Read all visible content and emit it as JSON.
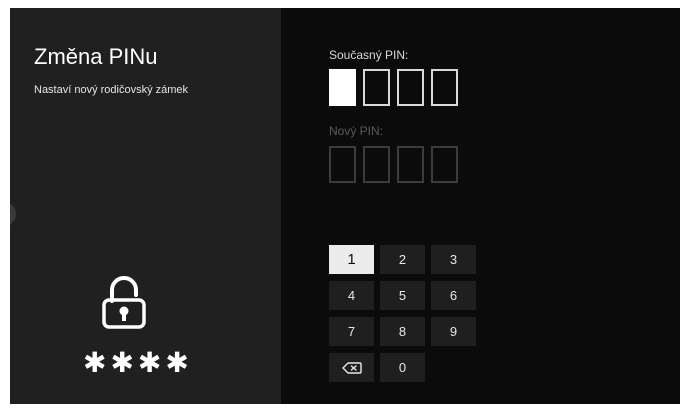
{
  "left": {
    "title": "Změna PINu",
    "subtitle": "Nastaví nový rodičovský zámek",
    "masked_pin": "✱✱✱✱",
    "lock_icon": "padlock-icon"
  },
  "current_pin": {
    "label": "Současný PIN:",
    "digits": 4,
    "active_index": 0
  },
  "new_pin": {
    "label": "Nový PIN:",
    "digits": 4
  },
  "keypad": {
    "keys": [
      "1",
      "2",
      "3",
      "4",
      "5",
      "6",
      "7",
      "8",
      "9"
    ],
    "zero": "0",
    "backspace_icon": "backspace-icon",
    "focused_key": "1"
  },
  "colors": {
    "background": "#0b0b0b",
    "left_panel": "#202020",
    "key_bg": "#1f1f1f",
    "key_focused_bg": "#ececec"
  }
}
